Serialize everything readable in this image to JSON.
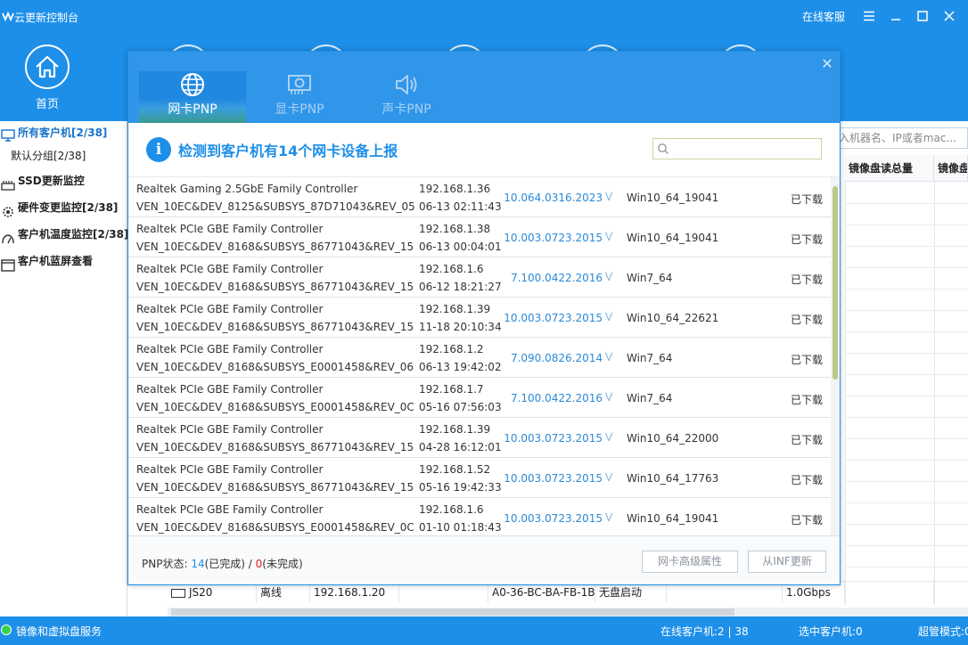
{
  "window": {
    "app_icon": "yun-logo",
    "title": "云更新控制台",
    "online_service": "在线客服"
  },
  "nav": {
    "home_label": "首页"
  },
  "sidebar": {
    "all_clients": "所有客户机[2/38]",
    "default_group": "默认分组[2/38]",
    "items": [
      {
        "label": "SSD更新监控",
        "icon": "ssd-icon"
      },
      {
        "label": "硬件变更监控[2/38]",
        "icon": "gear-icon"
      },
      {
        "label": "客户机温度监控[2/38]",
        "icon": "thermometer-icon"
      },
      {
        "label": "客户机蓝屏查看",
        "icon": "screen-icon"
      }
    ]
  },
  "background": {
    "search_placeholder": "入机器名、IP或者mac...",
    "headers": [
      "镜像盘读总量",
      "镜像盘"
    ],
    "row": [
      "JS20",
      "离线",
      "192.168.1.20",
      "",
      "A0-36-BC-BA-FB-1B",
      "无盘启动",
      "",
      "1.0Gbps"
    ]
  },
  "dialog": {
    "tabs": [
      {
        "label": "网卡PNP",
        "icon": "globe-icon",
        "active": true
      },
      {
        "label": "显卡PNP",
        "icon": "gpu-icon",
        "active": false
      },
      {
        "label": "声卡PNP",
        "icon": "speaker-icon",
        "active": false
      }
    ],
    "info_text": "检测到客户机有14个网卡设备上报",
    "search_placeholder": "",
    "rows": [
      {
        "name": "Realtek Gaming 2.5GbE Family Controller",
        "hwid": "VEN_10EC&DEV_8125&SUBSYS_87D71043&REV_05",
        "ip": "192.168.1.36",
        "time": "06-13 02:11:43",
        "version": "10.064.0316.2023",
        "os": "Win10_64_19041",
        "status": "已下载"
      },
      {
        "name": "Realtek PCIe GBE Family Controller",
        "hwid": "VEN_10EC&DEV_8168&SUBSYS_86771043&REV_15",
        "ip": "192.168.1.38",
        "time": "06-13 00:04:01",
        "version": "10.003.0723.2015",
        "os": "Win10_64_19041",
        "status": "已下载"
      },
      {
        "name": "Realtek PCIe GBE Family Controller",
        "hwid": "VEN_10EC&DEV_8168&SUBSYS_86771043&REV_15",
        "ip": "192.168.1.6",
        "time": "06-12 18:21:27",
        "version": "7.100.0422.2016",
        "os": "Win7_64",
        "status": "已下载"
      },
      {
        "name": "Realtek PCIe GBE Family Controller",
        "hwid": "VEN_10EC&DEV_8168&SUBSYS_86771043&REV_15",
        "ip": "192.168.1.39",
        "time": "11-18 20:10:34",
        "version": "10.003.0723.2015",
        "os": "Win10_64_22621",
        "status": "已下载"
      },
      {
        "name": "Realtek PCIe GBE Family Controller",
        "hwid": "VEN_10EC&DEV_8168&SUBSYS_E0001458&REV_06",
        "ip": "192.168.1.2",
        "time": "06-13 19:42:02",
        "version": "7.090.0826.2014",
        "os": "Win7_64",
        "status": "已下载"
      },
      {
        "name": "Realtek PCIe GBE Family Controller",
        "hwid": "VEN_10EC&DEV_8168&SUBSYS_E0001458&REV_0C",
        "ip": "192.168.1.7",
        "time": "05-16 07:56:03",
        "version": "7.100.0422.2016",
        "os": "Win7_64",
        "status": "已下载"
      },
      {
        "name": "Realtek PCIe GBE Family Controller",
        "hwid": "VEN_10EC&DEV_8168&SUBSYS_86771043&REV_15",
        "ip": "192.168.1.39",
        "time": "04-28 16:12:01",
        "version": "10.003.0723.2015",
        "os": "Win10_64_22000",
        "status": "已下载"
      },
      {
        "name": "Realtek PCIe GBE Family Controller",
        "hwid": "VEN_10EC&DEV_8168&SUBSYS_86771043&REV_15",
        "ip": "192.168.1.52",
        "time": "05-16 19:42:33",
        "version": "10.003.0723.2015",
        "os": "Win10_64_17763",
        "status": "已下载"
      },
      {
        "name": "Realtek PCIe GBE Family Controller",
        "hwid": "VEN_10EC&DEV_8168&SUBSYS_E0001458&REV_0C",
        "ip": "192.168.1.6",
        "time": "01-10 01:18:43",
        "version": "10.003.0723.2015",
        "os": "Win10_64_19041",
        "status": "已下载"
      }
    ],
    "footer": {
      "status_label": "PNP状态: ",
      "done_count": "14",
      "done_label": "(已完成)",
      "sep": " / ",
      "pending_count": "0",
      "pending_label": "(未完成)",
      "advanced_button": "网卡高级属性",
      "inf_button": "从INF更新"
    }
  },
  "statusbar": {
    "service": "镜像和虚拟盘服务",
    "online": "在线客户机:2 | 38",
    "selected": "选中客户机:0",
    "super_mode": "超管模式:0"
  },
  "colors": {
    "brand": "#1e8fe8",
    "link": "#2a8ad8",
    "error": "#e02020",
    "online_dot": "#35d24b"
  }
}
